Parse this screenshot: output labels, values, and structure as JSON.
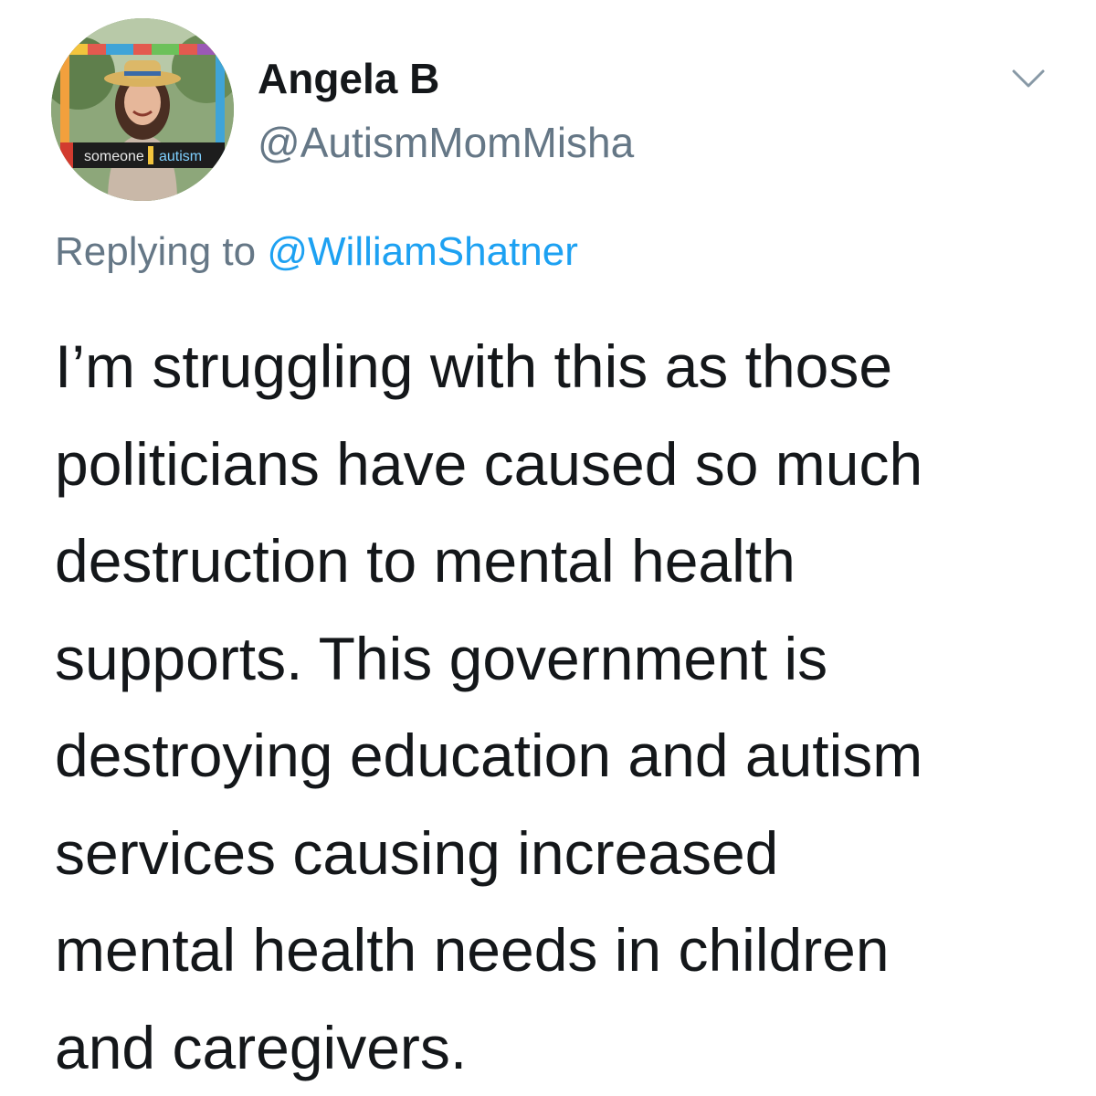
{
  "tweet": {
    "display_name": "Angela B",
    "handle": "@AutismMomMisha",
    "reply_prefix": "Replying to ",
    "reply_to": "@WilliamShatner",
    "avatar_sign_left": "someone",
    "avatar_sign_right": "autism",
    "menu_icon": "chevron-down-icon",
    "body_lines": [
      "I’m struggling with this as those",
      "politicians have caused so much",
      "destruction to mental health",
      "supports. This government is",
      "destroying education and autism",
      "services causing increased",
      "mental health needs in children",
      "and caregivers."
    ]
  },
  "colors": {
    "text_primary": "#14171a",
    "text_secondary": "#657786",
    "link": "#1da1f2",
    "background": "#ffffff"
  }
}
